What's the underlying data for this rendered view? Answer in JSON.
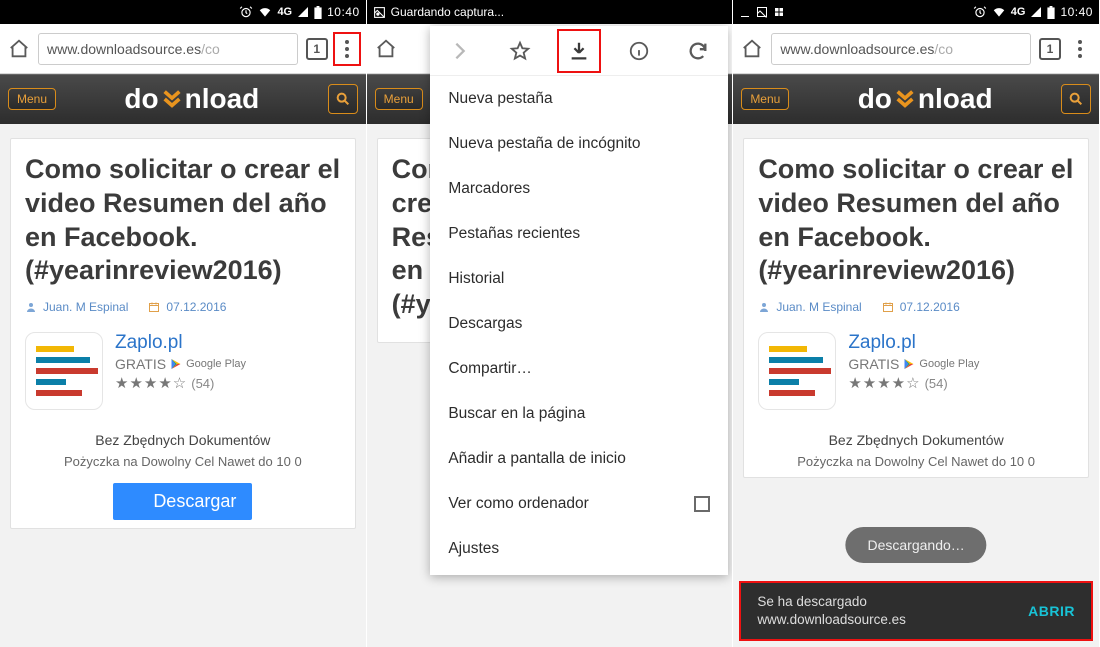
{
  "status": {
    "time": "10:40",
    "network": "4G",
    "saving_caption": "Guardando captura..."
  },
  "browser": {
    "url_main": "www.downloadsource.es",
    "url_rest": "/co",
    "tab_count": "1"
  },
  "site": {
    "menu_label": "Menu"
  },
  "article": {
    "title": "Como solicitar o crear el video Resumen del año en Facebook. (#yearinreview2016)",
    "title_cut": "Como solicitar o crear el video Resumen del año en F (#ye",
    "author": "Juan. M Espinal",
    "date": "07.12.2016"
  },
  "ad": {
    "title": "Zaplo.pl",
    "price": "GRATIS",
    "store": "Google Play",
    "rating_text": "★★★★☆",
    "rating_count": "(54)",
    "line1": "Bez Zbędnych Dokumentów",
    "line2": "Pożyczka na Dowolny Cel Nawet do 10 0",
    "cta": "Descargar"
  },
  "chrome_menu": {
    "items": [
      "Nueva pestaña",
      "Nueva pestaña de incógnito",
      "Marcadores",
      "Pestañas recientes",
      "Historial",
      "Descargas",
      "Compartir…",
      "Buscar en la página",
      "Añadir a pantalla de inicio",
      "Ver como ordenador",
      "Ajustes"
    ]
  },
  "pane3": {
    "toast": "Descargando…",
    "snack_line1": "Se ha descargado",
    "snack_line2": "www.downloadsource.es",
    "snack_action": "ABRIR"
  }
}
